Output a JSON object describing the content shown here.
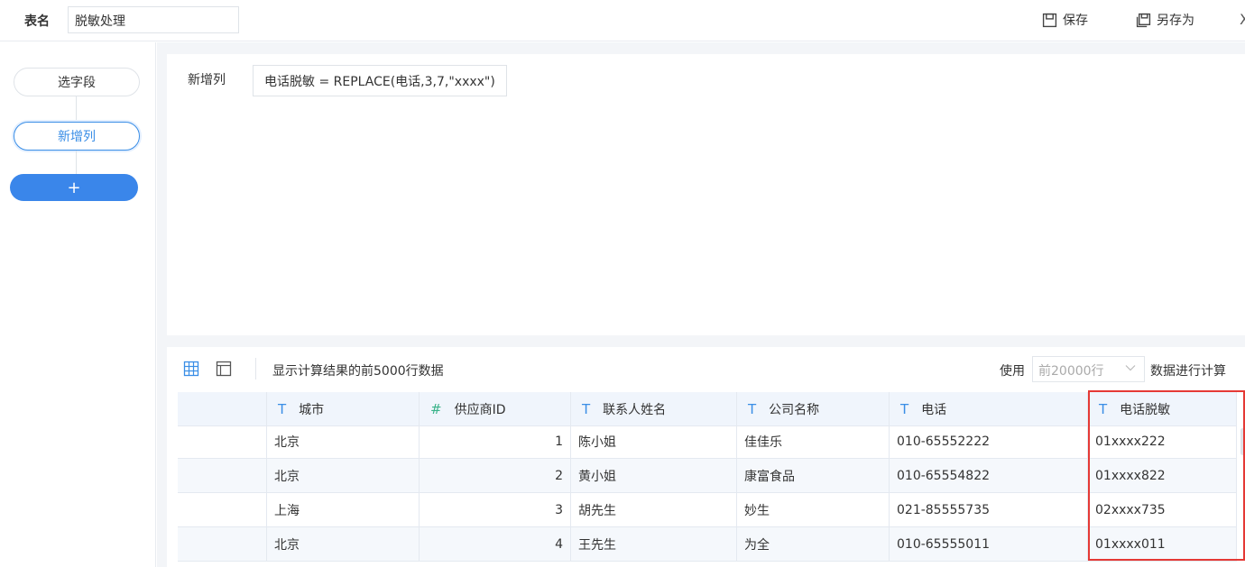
{
  "topbar": {
    "table_name_label": "表名",
    "table_name_value": "脱敏处理",
    "save_label": "保存",
    "save_as_label": "另存为",
    "close_glyph": "X"
  },
  "steps": {
    "items": [
      {
        "label": "选字段"
      },
      {
        "label": "新增列"
      }
    ],
    "add_label": "+"
  },
  "editor": {
    "label": "新增列",
    "formula": "电话脱敏 = REPLACE(电话,3,7,\"xxxx\")"
  },
  "preview": {
    "info": "显示计算结果的前5000行数据",
    "use_label": "使用",
    "row_limit_selected": "前20000行",
    "tail_label": "数据进行计算",
    "columns": [
      {
        "type_icon": "T",
        "name": "城市"
      },
      {
        "type_icon": "#",
        "name": "供应商ID"
      },
      {
        "type_icon": "T",
        "name": "联系人姓名"
      },
      {
        "type_icon": "T",
        "name": "公司名称"
      },
      {
        "type_icon": "T",
        "name": "电话"
      },
      {
        "type_icon": "T",
        "name": "电话脱敏"
      }
    ],
    "rows": [
      [
        "北京",
        "1",
        "陈小姐",
        "佳佳乐",
        "010-65552222",
        "01xxxx222"
      ],
      [
        "北京",
        "2",
        "黄小姐",
        "康富食品",
        "010-65554822",
        "01xxxx822"
      ],
      [
        "上海",
        "3",
        "胡先生",
        "妙生",
        "021-85555735",
        "02xxxx735"
      ],
      [
        "北京",
        "4",
        "王先生",
        "为全",
        "010-65555011",
        "01xxxx011"
      ]
    ]
  },
  "colors": {
    "accent": "#3a8ee6",
    "highlight_border": "#e53935"
  }
}
